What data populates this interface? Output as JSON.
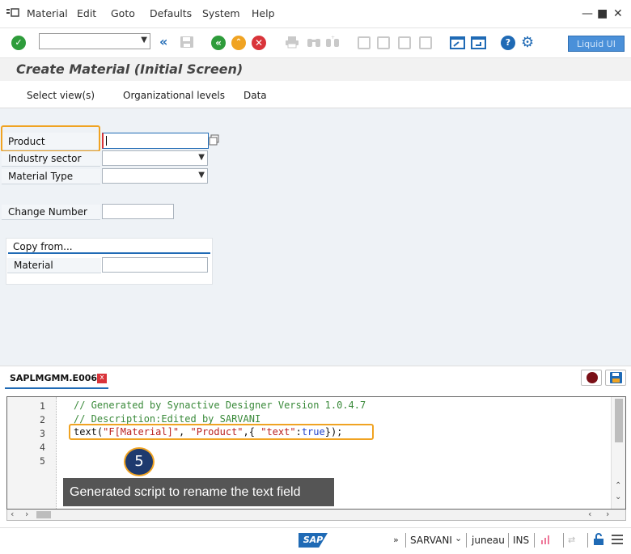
{
  "menubar": {
    "items": [
      "Material",
      "Edit",
      "Goto",
      "Defaults",
      "System",
      "Help"
    ],
    "window_controls": [
      "—",
      "■",
      "✕"
    ]
  },
  "toolbar": {
    "command_field": "",
    "liquid_ui_label": "Liquid UI",
    "icons": [
      "enter-icon",
      "back-icon",
      "exit-icon",
      "cancel-icon",
      "save-icon",
      "help-icon",
      "settings-icon"
    ]
  },
  "title": "Create Material (Initial Screen)",
  "app_toolbar": {
    "select_views": "Select view(s)",
    "org_levels": "Organizational levels",
    "data": "Data"
  },
  "form": {
    "product_label": "Product",
    "product_value": "",
    "industry_label": "Industry sector",
    "industry_value": "",
    "material_type_label": "Material Type",
    "material_type_value": "",
    "change_number_label": "Change Number",
    "change_number_value": "",
    "copy_from_title": "Copy from...",
    "copy_material_label": "Material",
    "copy_material_value": ""
  },
  "editor": {
    "tab_name": "SAPLMGMM.E0060",
    "close": "x",
    "line_numbers": [
      "1",
      "2",
      "3",
      "4",
      "5"
    ],
    "lines": [
      "// Generated by Synactive Designer Version 1.0.4.7",
      "// Description:Edited by SARVANI",
      "",
      "",
      ""
    ],
    "line3": {
      "fn": "text(",
      "arg1": "\"F[Material]\"",
      "sep1": ", ",
      "arg2": "\"Product\"",
      "sep2": ",{ ",
      "key": "\"text\"",
      "colon": ":",
      "val": "true",
      "end": "});"
    },
    "callout_number": "5",
    "callout_text": "Generated script to rename the text field"
  },
  "statusbar": {
    "sap_logo": "SAP",
    "user": "SARVANI",
    "server": "juneau",
    "mode": "INS"
  },
  "colors": {
    "accent_blue": "#1f6ab5",
    "highlight_orange": "#f0a322",
    "callout_bg": "#1e3a6e"
  }
}
